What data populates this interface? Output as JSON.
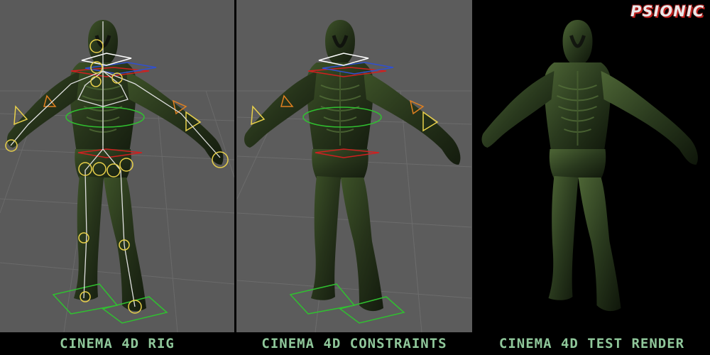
{
  "captions": {
    "rig": "CINEMA 4D RIG",
    "constraints": "CINEMA 4D CONSTRAINTS",
    "render": "CINEMA 4D TEST RENDER"
  },
  "logo": {
    "text": "PSIONIC"
  },
  "colors": {
    "viewport_bg": "#5a5a5a",
    "caption_text": "#8fc79a",
    "creature_skin": "#2b3a1c",
    "bone_white": "#e0e0e0",
    "joint_yellow": "#e8d04a",
    "control_red": "#d02020",
    "control_blue": "#3050d0",
    "control_green": "#30c030",
    "control_orange": "#e08020"
  },
  "icons": {
    "creature": "swamp-creature-figure",
    "logo": "psionic-graffiti-logo"
  }
}
